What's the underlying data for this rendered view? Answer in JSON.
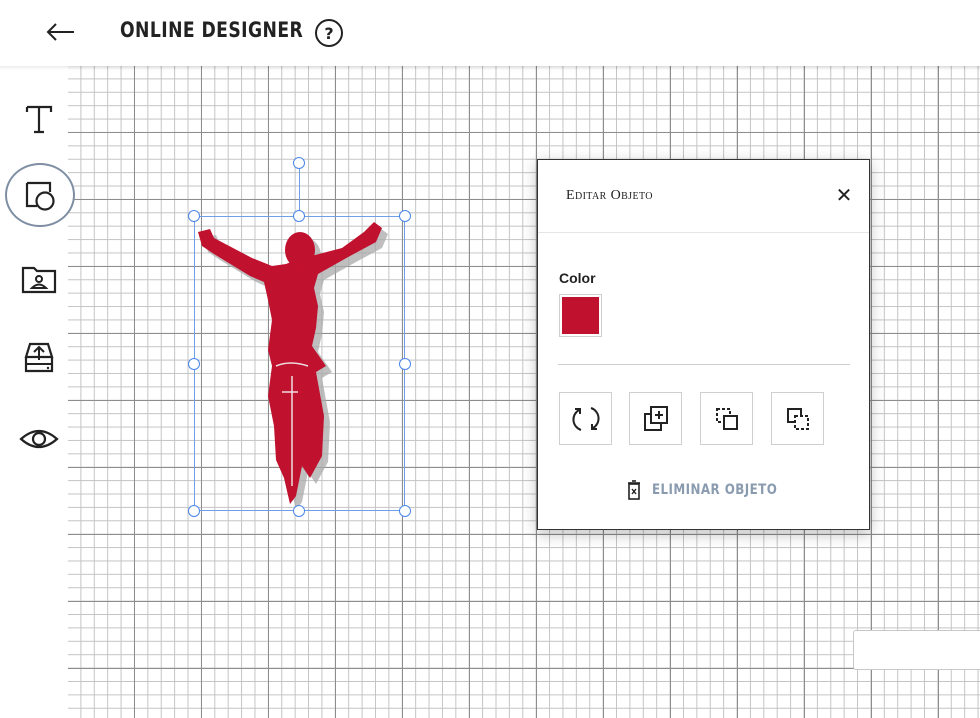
{
  "header": {
    "back_icon": "arrow-left-icon",
    "title": "ONLINE DESIGNER",
    "help_label": "?"
  },
  "toolbar": {
    "items": [
      {
        "icon": "text-icon",
        "active": false
      },
      {
        "icon": "shapes-icon",
        "active": true
      },
      {
        "icon": "image-folder-icon",
        "active": false
      },
      {
        "icon": "upload-icon",
        "active": false
      },
      {
        "icon": "eye-icon",
        "active": false
      }
    ]
  },
  "canvas": {
    "object": {
      "icon": "cyclist-silhouette",
      "color": "#c0112f"
    }
  },
  "edit_panel": {
    "title": "Editar Objeto",
    "close_icon": "close-icon",
    "color_label": "Color",
    "color_value": "#c0112f",
    "actions": [
      {
        "icon": "flip-icon"
      },
      {
        "icon": "duplicate-icon"
      },
      {
        "icon": "bring-forward-icon"
      },
      {
        "icon": "send-backward-icon"
      }
    ],
    "delete_label": "ELIMINAR OBJETO",
    "delete_icon": "trash-icon"
  }
}
